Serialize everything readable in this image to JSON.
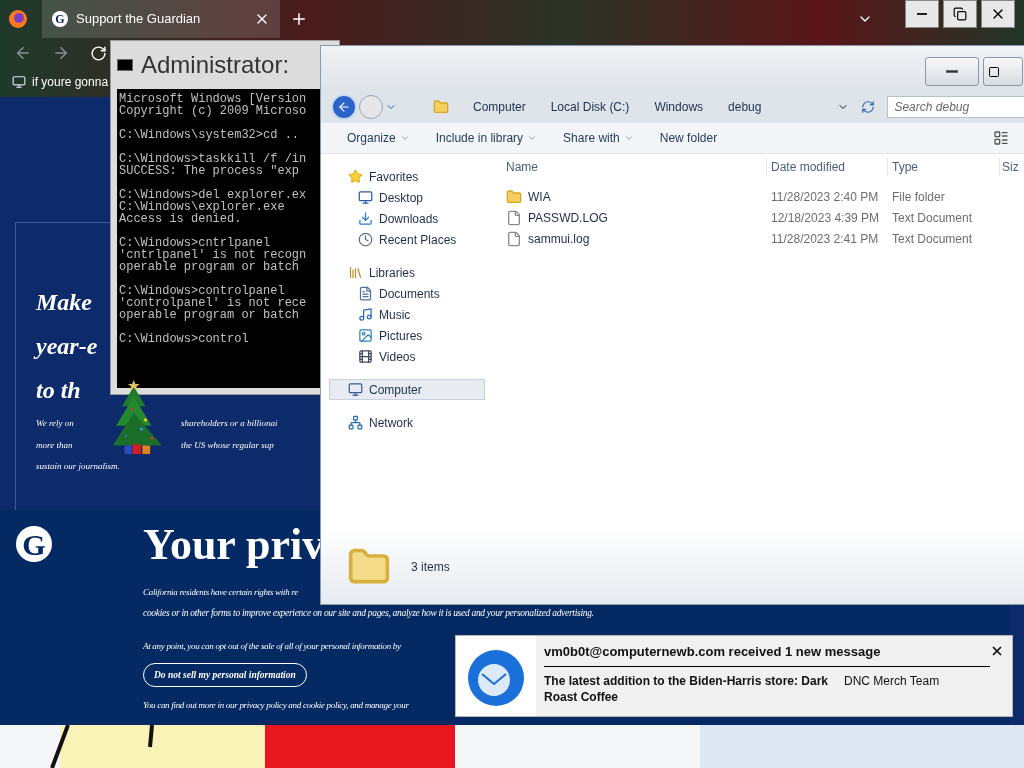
{
  "browser": {
    "tabs": [
      {
        "favicon": "G",
        "title": "Support the Guardian",
        "selected": true
      }
    ],
    "bookmarks": [
      "if youre gonna"
    ]
  },
  "page": {
    "heading_lines": [
      "Make",
      "year-e",
      "to th"
    ],
    "body_rows": [
      [
        "We rely on",
        "shareholders or a billionai"
      ],
      [
        "more than",
        "the US whose regular sup"
      ],
      [
        "sustain our journalism."
      ]
    ],
    "privacy": {
      "logo": "G",
      "title": "Your priv",
      "paragraphs": [
        "California residents have certain rights with re",
        "cookies or in other forms to improve experience on our site and pages, analyze how it is used and your personalized advertising.",
        "At any point, you can opt out of the sale of all of your personal information by"
      ],
      "button": "Do not sell my personal information",
      "footer": "You can find out more in our privacy policy and cookie policy, and manage your"
    }
  },
  "terminal": {
    "title": "Administrator: ",
    "blocks": [
      [
        "Microsoft Windows [Version",
        "Copyright (c) 2009 Microso"
      ],
      [
        "C:\\Windows\\system32>cd .."
      ],
      [
        "C:\\Windows>taskkill /f /in",
        "SUCCESS: The process \"exp"
      ],
      [
        "C:\\Windows>del explorer.ex",
        "C:\\Windows\\explorer.exe",
        "Access is denied."
      ],
      [
        "C:\\Windows>cntrlpanel",
        "'cntrlpanel' is not recogn",
        "operable program or batch"
      ],
      [
        "C:\\Windows>controlpanel",
        "'controlpanel' is not rece",
        "operable program or batch"
      ],
      [
        "C:\\Windows>control"
      ]
    ]
  },
  "explorer": {
    "breadcrumb": [
      "Computer",
      "Local Disk (C:)",
      "Windows",
      "debug"
    ],
    "search": {
      "placeholder": "Search debug"
    },
    "toolbar": [
      {
        "label": "Organize",
        "dropdown": true
      },
      {
        "label": "Include in library",
        "dropdown": true
      },
      {
        "label": "Share with",
        "dropdown": true
      },
      {
        "label": "New folder",
        "dropdown": false
      }
    ],
    "nav": [
      {
        "label": "Favorites",
        "kind": "star",
        "selected": false,
        "children": [
          {
            "label": "Desktop",
            "kind": "desktop",
            "selected": false
          },
          {
            "label": "Downloads",
            "kind": "downloads",
            "selected": false
          },
          {
            "label": "Recent Places",
            "kind": "recent",
            "selected": false
          }
        ]
      },
      {
        "label": "Libraries",
        "kind": "library",
        "selected": false,
        "children": [
          {
            "label": "Documents",
            "kind": "documents",
            "selected": false
          },
          {
            "label": "Music",
            "kind": "music",
            "selected": false
          },
          {
            "label": "Pictures",
            "kind": "pictures",
            "selected": false
          },
          {
            "label": "Videos",
            "kind": "videos",
            "selected": false
          }
        ]
      },
      {
        "label": "Computer",
        "kind": "computer",
        "selected": true
      },
      {
        "label": "Network",
        "kind": "network",
        "selected": false
      }
    ],
    "columns": [
      "Name",
      "Date modified",
      "Type",
      "Siz"
    ],
    "files": [
      {
        "kind": "folder",
        "name": "WIA",
        "date": "11/28/2023 2:40 PM",
        "type": "File folder"
      },
      {
        "kind": "text",
        "name": "PASSWD.LOG",
        "date": "12/18/2023 4:39 PM",
        "type": "Text Document"
      },
      {
        "kind": "text",
        "name": "sammui.log",
        "date": "11/28/2023 2:41 PM",
        "type": "Text Document"
      }
    ],
    "status": "3 items"
  },
  "notification": {
    "title": "vm0b0t@computernewb.com received 1 new message",
    "subject": "The latest addition to the Biden-Harris store: Dark Roast Coffee",
    "sender": "DNC Merch Team"
  }
}
